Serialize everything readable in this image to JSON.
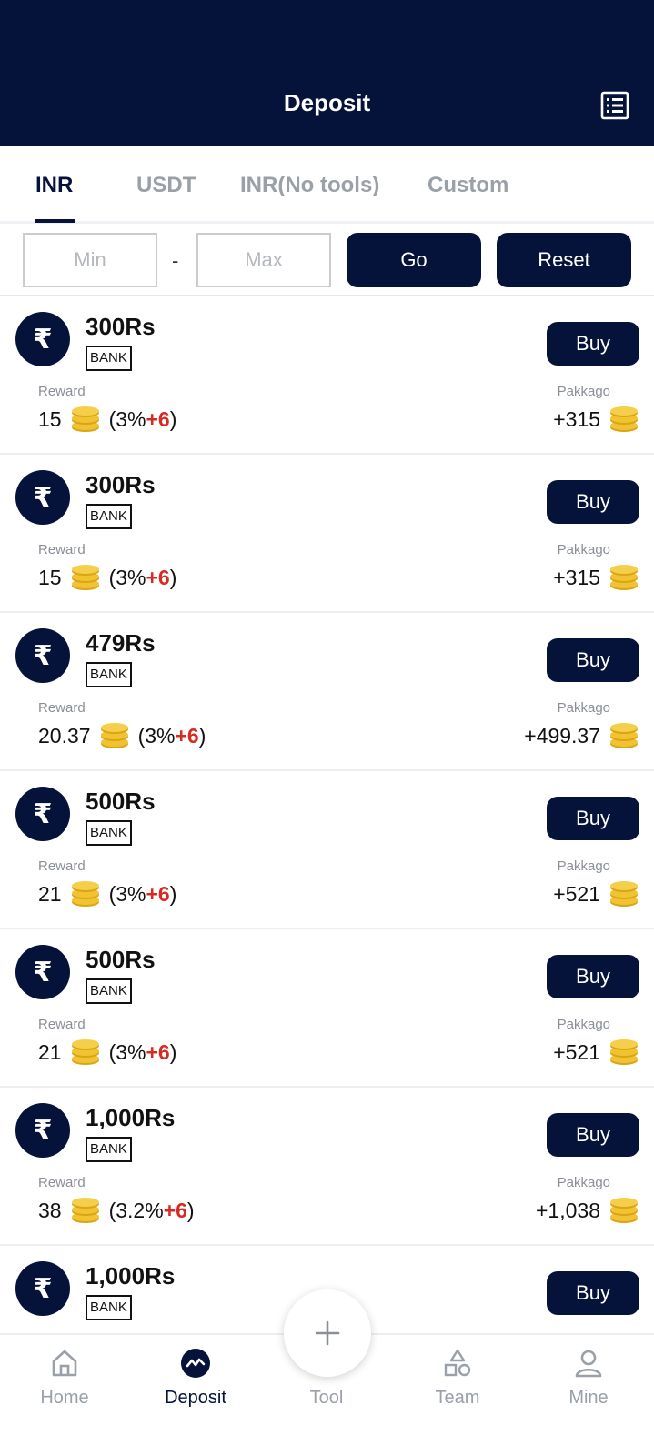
{
  "header": {
    "title": "Deposit",
    "list_icon": "list-icon"
  },
  "tabs": [
    {
      "label": "INR",
      "active": true
    },
    {
      "label": "USDT",
      "active": false
    },
    {
      "label": "INR(No tools)",
      "active": false
    },
    {
      "label": "Custom",
      "active": false
    }
  ],
  "filter": {
    "min_placeholder": "Min",
    "max_placeholder": "Max",
    "separator": "-",
    "go_label": "Go",
    "reset_label": "Reset"
  },
  "items": [
    {
      "amount": "300Rs",
      "method": "BANK",
      "buy": "Buy",
      "reward_label": "Reward",
      "reward": "15",
      "pct_open": "(3%",
      "bonus": "+6",
      "pct_close": ")",
      "package_label": "Pakkago",
      "package": "+315"
    },
    {
      "amount": "300Rs",
      "method": "BANK",
      "buy": "Buy",
      "reward_label": "Reward",
      "reward": "15",
      "pct_open": "(3%",
      "bonus": "+6",
      "pct_close": ")",
      "package_label": "Pakkago",
      "package": "+315"
    },
    {
      "amount": "479Rs",
      "method": "BANK",
      "buy": "Buy",
      "reward_label": "Reward",
      "reward": "20.37",
      "pct_open": "(3%",
      "bonus": "+6",
      "pct_close": ")",
      "package_label": "Pakkago",
      "package": "+499.37"
    },
    {
      "amount": "500Rs",
      "method": "BANK",
      "buy": "Buy",
      "reward_label": "Reward",
      "reward": "21",
      "pct_open": "(3%",
      "bonus": "+6",
      "pct_close": ")",
      "package_label": "Pakkago",
      "package": "+521"
    },
    {
      "amount": "500Rs",
      "method": "BANK",
      "buy": "Buy",
      "reward_label": "Reward",
      "reward": "21",
      "pct_open": "(3%",
      "bonus": "+6",
      "pct_close": ")",
      "package_label": "Pakkago",
      "package": "+521"
    },
    {
      "amount": "1,000Rs",
      "method": "BANK",
      "buy": "Buy",
      "reward_label": "Reward",
      "reward": "38",
      "pct_open": "(3.2%",
      "bonus": "+6",
      "pct_close": ")",
      "package_label": "Pakkago",
      "package": "+1,038"
    },
    {
      "amount": "1,000Rs",
      "method": "BANK",
      "buy": "Buy"
    }
  ],
  "rupee_symbol": "₹",
  "nav": [
    {
      "label": "Home",
      "icon": "home-icon",
      "active": false
    },
    {
      "label": "Deposit",
      "icon": "deposit-icon",
      "active": true
    },
    {
      "label": "Tool",
      "icon": "plus-icon",
      "active": false
    },
    {
      "label": "Team",
      "icon": "team-icon",
      "active": false
    },
    {
      "label": "Mine",
      "icon": "user-icon",
      "active": false
    }
  ],
  "colors": {
    "primary": "#05123a",
    "bonus": "#d82a20",
    "muted": "#9aa0a8",
    "coin": "#f1c232"
  }
}
